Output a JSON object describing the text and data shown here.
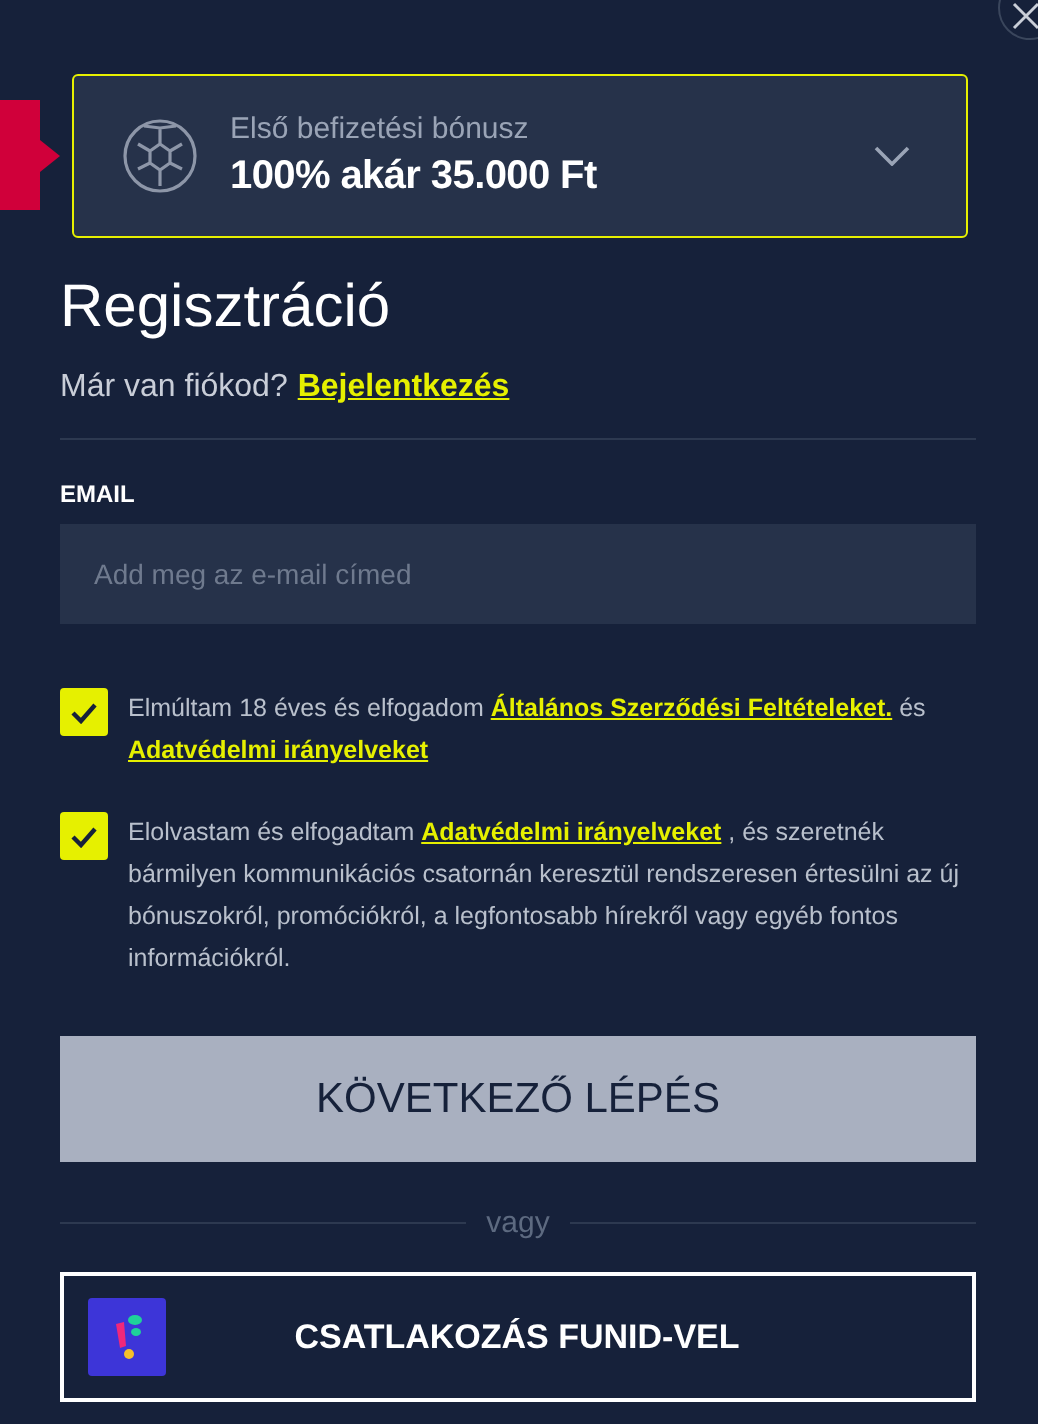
{
  "bonus": {
    "label": "Első befizetési bónusz",
    "amount": "100% akár 35.000 Ft",
    "expanded": false
  },
  "title": "Regisztráció",
  "login_prompt": {
    "text": "Már van fiókod?",
    "link": "Bejelentkezés"
  },
  "email": {
    "label": "EMAIL",
    "placeholder": "Add meg az e-mail címed"
  },
  "consents": [
    {
      "checked": true,
      "parts": [
        {
          "kind": "text",
          "text": "Elmúltam 18 éves és elfogadom "
        },
        {
          "kind": "link",
          "text": "Általános Szerződési Feltételeket."
        },
        {
          "kind": "text",
          "text": " és "
        },
        {
          "kind": "link",
          "text": "Adatvédelmi irányelveket"
        }
      ]
    },
    {
      "checked": true,
      "parts": [
        {
          "kind": "text",
          "text": "Elolvastam és elfogadtam "
        },
        {
          "kind": "link",
          "text": "Adatvédelmi irányelveket"
        },
        {
          "kind": "text",
          "text": " , és szeretnék bármilyen kommunikációs csatornán keresztül rendszeresen értesülni az új bónuszokról, promóciókról, a legfontosabb hírekről vagy egyéb fontos információkról."
        }
      ]
    }
  ],
  "next_button": {
    "label": "KÖVETKEZŐ LÉPÉS",
    "disabled": true
  },
  "separator": "vagy",
  "funid_button": {
    "label": "CSATLAKOZÁS FUNID-VEL"
  }
}
